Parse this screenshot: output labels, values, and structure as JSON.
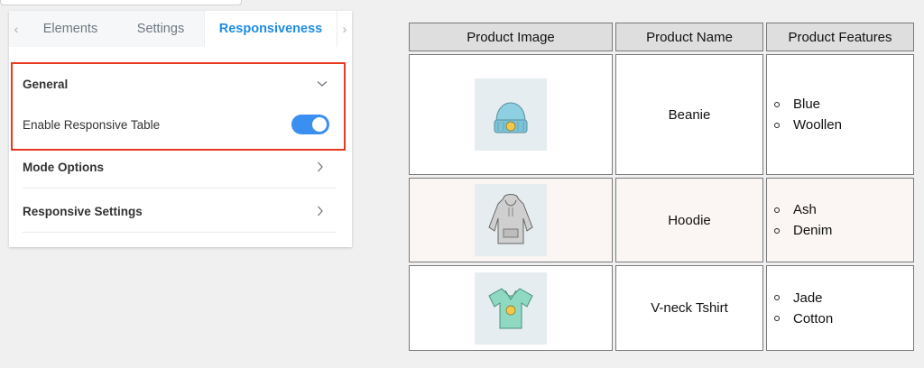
{
  "panel": {
    "tabs": [
      {
        "label": "Elements"
      },
      {
        "label": "Settings"
      },
      {
        "label": "Responsiveness"
      }
    ],
    "sections": {
      "general": {
        "title": "General",
        "enable_label": "Enable Responsive Table",
        "enabled": true
      },
      "mode": {
        "title": "Mode Options"
      },
      "responsive": {
        "title": "Responsive Settings"
      }
    },
    "accent": "#1f8ce6",
    "highlight_color": "#e8381f"
  },
  "table": {
    "headers": [
      "Product Image",
      "Product Name",
      "Product Features"
    ],
    "rows": [
      {
        "image": "beanie-image",
        "name": "Beanie",
        "features": [
          "Blue",
          "Woollen"
        ]
      },
      {
        "image": "hoodie-image",
        "name": "Hoodie",
        "features": [
          "Ash",
          "Denim"
        ]
      },
      {
        "image": "tshirt-image",
        "name": "V-neck Tshirt",
        "features": [
          "Jade",
          "Cotton"
        ]
      }
    ]
  }
}
